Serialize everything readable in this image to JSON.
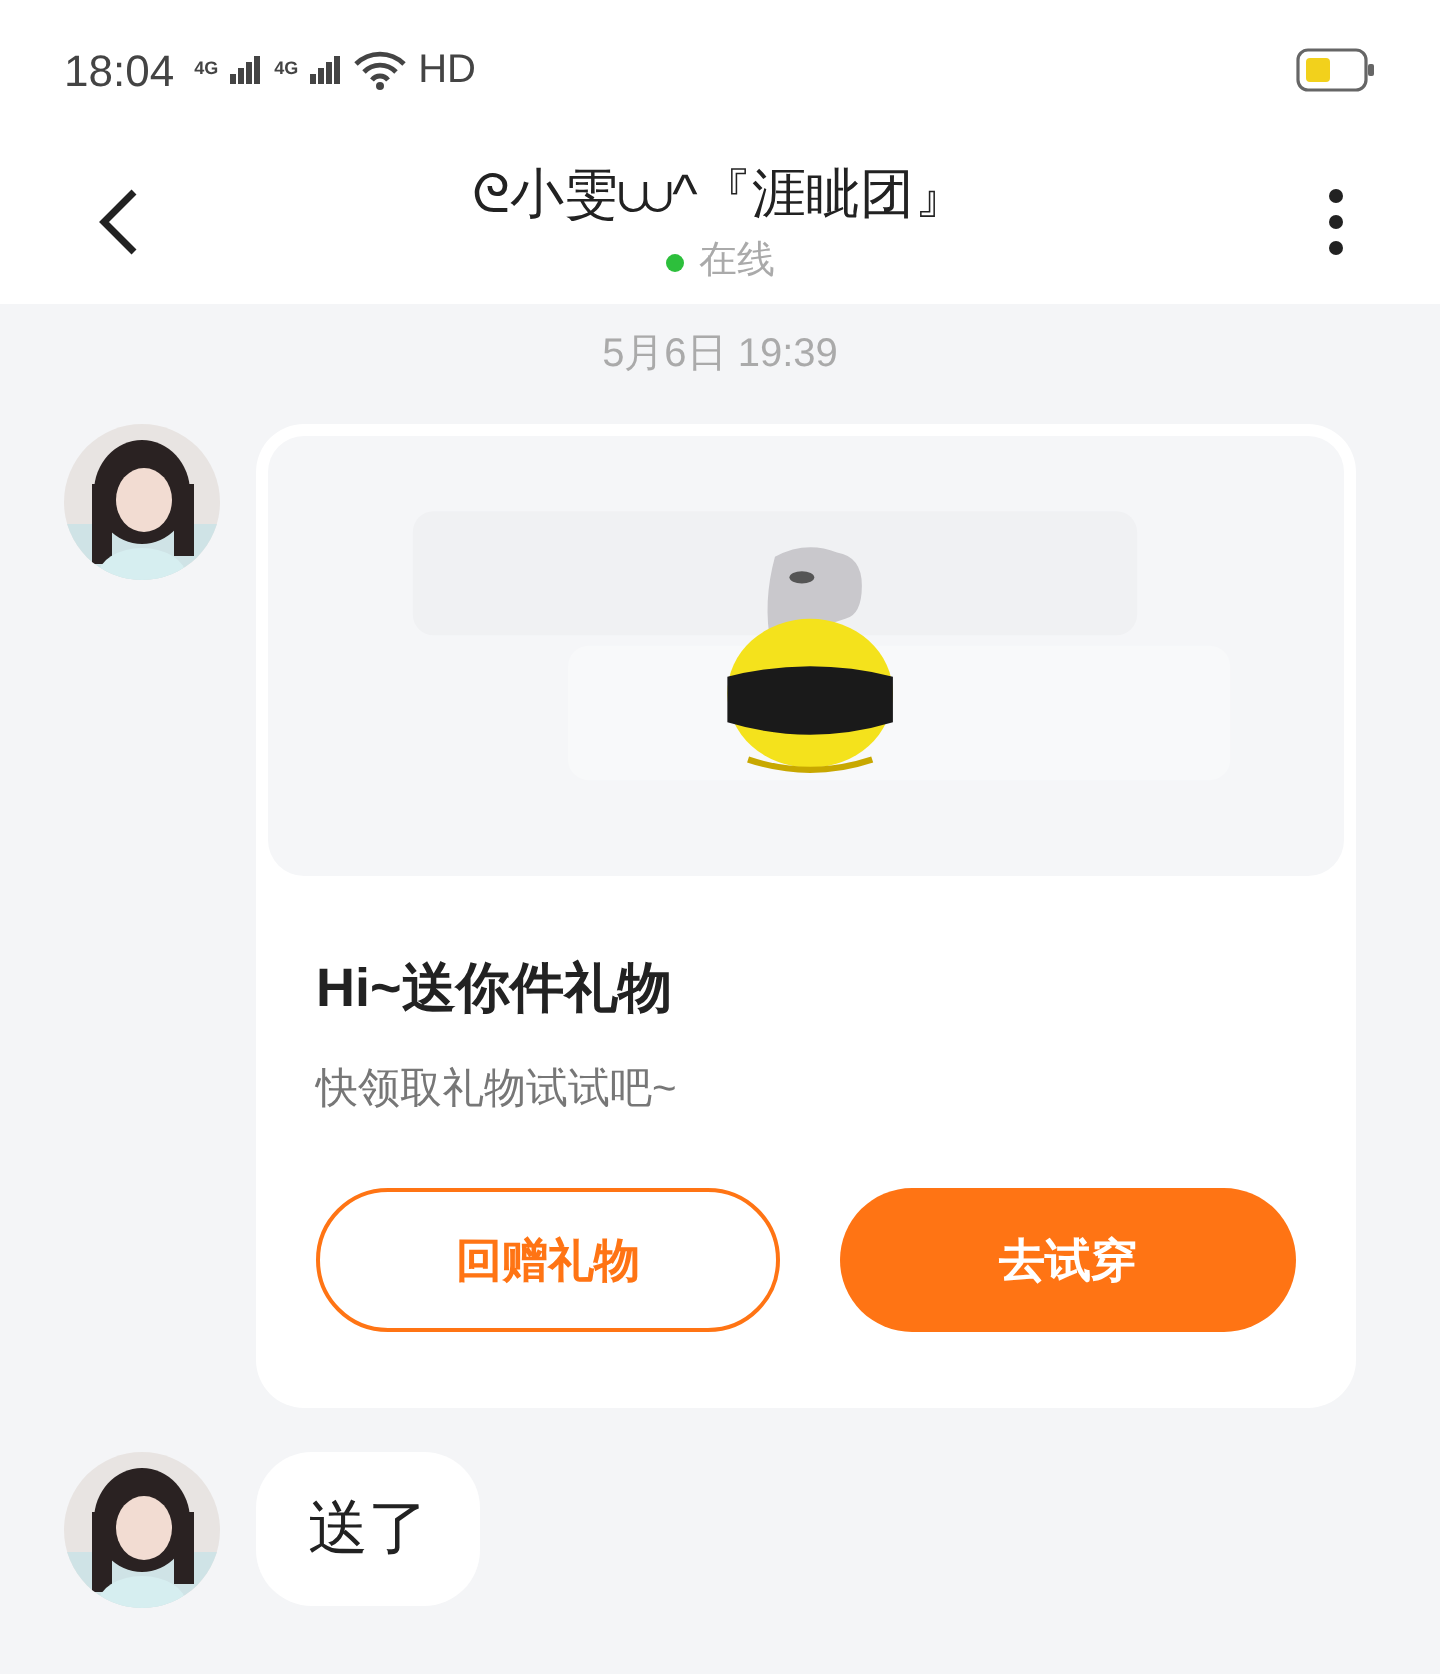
{
  "status_bar": {
    "time": "18:04",
    "network_1": "4G",
    "network_2": "4G",
    "hd": "HD"
  },
  "header": {
    "title": "ᘓ小雯⩊^『涯眦团』",
    "online": true,
    "status": "在线"
  },
  "messages": [
    {
      "kind": "time",
      "text": "5月6日 19:39"
    },
    {
      "kind": "gift",
      "image": {
        "kind": "picture"
      },
      "title": "Hi~送你件礼物",
      "subtitle": "快领取礼物试试吧~",
      "buttons": [
        {
          "label": "回赠礼物",
          "primary": false
        },
        {
          "label": "去试穿",
          "primary": true
        }
      ]
    },
    {
      "kind": "text",
      "text": "送了"
    }
  ]
}
